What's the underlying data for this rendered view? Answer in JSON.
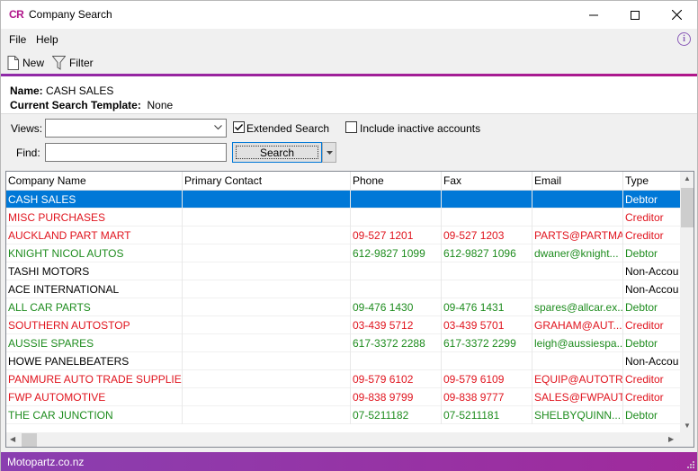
{
  "window": {
    "logo": "CR",
    "title": "Company Search"
  },
  "menu": {
    "file": "File",
    "help": "Help"
  },
  "toolbar": {
    "new_label": "New",
    "filter_label": "Filter"
  },
  "info": {
    "name_label": "Name:",
    "name_value": "CASH SALES",
    "template_label": "Current Search Template:",
    "template_value": "None"
  },
  "search": {
    "views_label": "Views:",
    "views_value": "",
    "extended_label": "Extended Search",
    "extended_checked": true,
    "inactive_label": "Include inactive accounts",
    "inactive_checked": false,
    "find_label": "Find:",
    "find_value": "",
    "search_button": "Search"
  },
  "grid": {
    "columns": [
      "Company Name",
      "Primary Contact",
      "Phone",
      "Fax",
      "Email",
      "Type"
    ],
    "rows": [
      {
        "name": "CASH SALES",
        "contact": "",
        "phone": "",
        "fax": "",
        "email": "",
        "type": "Debtor",
        "color": "#ffffff",
        "selected": true
      },
      {
        "name": "MISC PURCHASES",
        "contact": "",
        "phone": "",
        "fax": "",
        "email": "",
        "type": "Creditor",
        "color": "#e0141e"
      },
      {
        "name": "AUCKLAND PART MART",
        "contact": "",
        "phone": "09-527 1201",
        "fax": "09-527 1203",
        "email": "PARTS@PARTMA...",
        "type": "Creditor",
        "color": "#e0141e"
      },
      {
        "name": "KNIGHT NICOL AUTOS",
        "contact": "",
        "phone": "612-9827 1099",
        "fax": "612-9827 1096",
        "email": "dwaner@knight...",
        "type": "Debtor",
        "color": "#1e8c1e"
      },
      {
        "name": "TASHI MOTORS",
        "contact": "",
        "phone": "",
        "fax": "",
        "email": "",
        "type": "Non-Accou",
        "color": "#000000"
      },
      {
        "name": "ACE INTERNATIONAL",
        "contact": "",
        "phone": "",
        "fax": "",
        "email": "",
        "type": "Non-Accou",
        "color": "#000000"
      },
      {
        "name": "ALL CAR PARTS",
        "contact": "",
        "phone": "09-476 1430",
        "fax": "09-476 1431",
        "email": "spares@allcar.ex...",
        "type": "Debtor",
        "color": "#1e8c1e"
      },
      {
        "name": "SOUTHERN AUTOSTOP",
        "contact": "",
        "phone": "03-439 5712",
        "fax": "03-439 5701",
        "email": "GRAHAM@AUT...",
        "type": "Creditor",
        "color": "#e0141e"
      },
      {
        "name": "AUSSIE SPARES",
        "contact": "",
        "phone": "617-3372 2288",
        "fax": "617-3372 2299",
        "email": "leigh@aussiespa...",
        "type": "Debtor",
        "color": "#1e8c1e"
      },
      {
        "name": "HOWE PANELBEATERS",
        "contact": "",
        "phone": "",
        "fax": "",
        "email": "",
        "type": "Non-Accou",
        "color": "#000000"
      },
      {
        "name": "PANMURE AUTO TRADE SUPPLIERS",
        "contact": "",
        "phone": "09-579 6102",
        "fax": "09-579 6109",
        "email": "EQUIP@AUTOTR...",
        "type": "Creditor",
        "color": "#e0141e"
      },
      {
        "name": "FWP AUTOMOTIVE",
        "contact": "",
        "phone": "09-838 9799",
        "fax": "09-838 9777",
        "email": "SALES@FWPAUT...",
        "type": "Creditor",
        "color": "#e0141e"
      },
      {
        "name": "THE CAR JUNCTION",
        "contact": "",
        "phone": "07-5211182",
        "fax": "07-5211181",
        "email": "SHELBYQUINN...",
        "type": "Debtor",
        "color": "#1e8c1e"
      }
    ]
  },
  "status": {
    "text": "Motopartz.co.nz"
  },
  "colors": {
    "accent": "#8f2aa8",
    "selection": "#0078d7",
    "creditor": "#e0141e",
    "debtor": "#1e8c1e"
  }
}
